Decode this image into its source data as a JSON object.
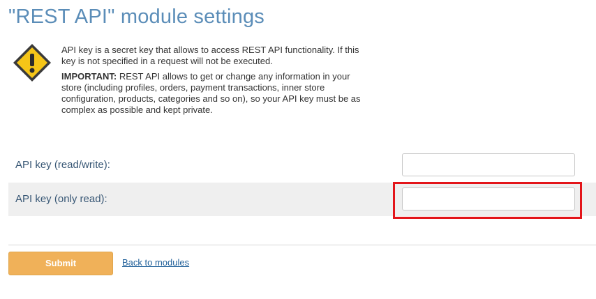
{
  "page": {
    "title": "\"REST API\" module settings"
  },
  "warning": {
    "icon": "warning-icon",
    "paragraph_1": "API key is a secret key that allows to access REST API functionality. If this key is not specified in a request will not be executed.",
    "important_label": "IMPORTANT:",
    "paragraph_2_rest": " REST API allows to get or change any information in your store (including profiles, orders, payment transactions, inner store configuration, products, categories and so on), so your API key must be as complex as possible and kept private."
  },
  "form": {
    "fields": [
      {
        "label": "API key (read/write):",
        "value": "",
        "placeholder": ""
      },
      {
        "label": "API key (only read):",
        "value": "",
        "placeholder": ""
      }
    ]
  },
  "actions": {
    "submit_label": "Submit",
    "back_link_label": "Back to modules"
  },
  "colors": {
    "title": "#5b8db8",
    "label": "#385775",
    "submit_bg": "#f0b159",
    "highlight": "#e3151a",
    "link": "#1f5f99",
    "warning_icon_fill": "#f5c518"
  }
}
